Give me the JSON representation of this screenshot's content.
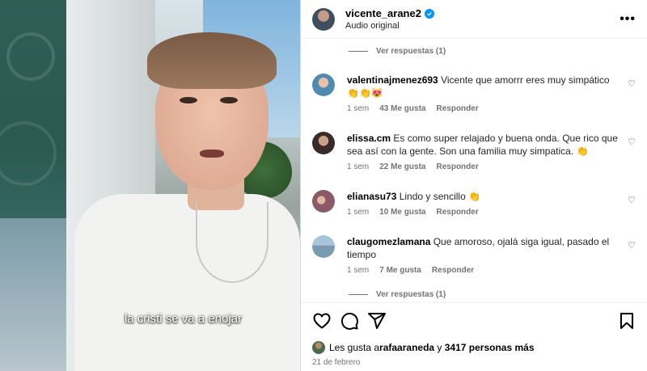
{
  "video": {
    "caption": "la cristi se va a enojar"
  },
  "post": {
    "username": "vicente_arane2",
    "audio": "Audio original",
    "more_label": "•••"
  },
  "comments": {
    "view_replies_top": "Ver respuestas (1)",
    "view_replies_bottom": "Ver respuestas (1)",
    "items": [
      {
        "user": "valentinajmenez693",
        "text": "Vicente que amorrr eres muy simpático 👏👏😻",
        "time": "1 sem",
        "likes": "43 Me gusta",
        "reply": "Responder",
        "avatar_color": "#4f8ab0"
      },
      {
        "user": "elissa.cm",
        "text": "Es como super relajado y buena onda. Que rico que sea así con la gente. Son una familia muy simpatica. 👏",
        "time": "1 sem",
        "likes": "22 Me gusta",
        "reply": "Responder",
        "avatar_color": "#3a2a2a"
      },
      {
        "user": "elianasu73",
        "text": "Lindo y sencillo 👏",
        "time": "1 sem",
        "likes": "10 Me gusta",
        "reply": "Responder",
        "avatar_color": "#8a5a6a"
      },
      {
        "user": "claugomezlamana",
        "text": "Que amoroso, ojalá siga igual, pasado el tiempo",
        "time": "1 sem",
        "likes": "7 Me gusta",
        "reply": "Responder",
        "avatar_color": "#7a9ab0"
      }
    ]
  },
  "likes": {
    "prefix": "Les gusta a ",
    "user": "rafaaraneda",
    "middle": " y ",
    "count": "3417 personas más"
  },
  "date": "21 de febrero",
  "colors": {
    "verified": "#0095f6",
    "muted": "#737373"
  }
}
